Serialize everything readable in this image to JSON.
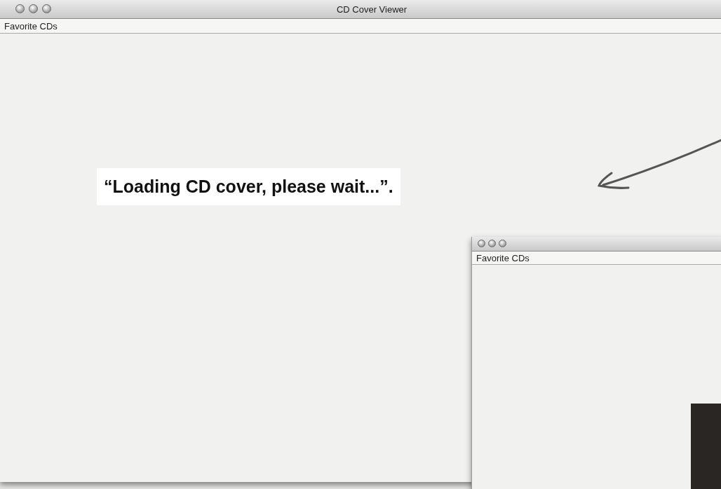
{
  "window": {
    "title": "CD Cover Viewer",
    "menu": [
      "Favorite CDs"
    ]
  },
  "annotation": {
    "text": "“Loading CD cover, please wait...”."
  },
  "second_window": {
    "menu": [
      "Favorite CDs"
    ]
  }
}
